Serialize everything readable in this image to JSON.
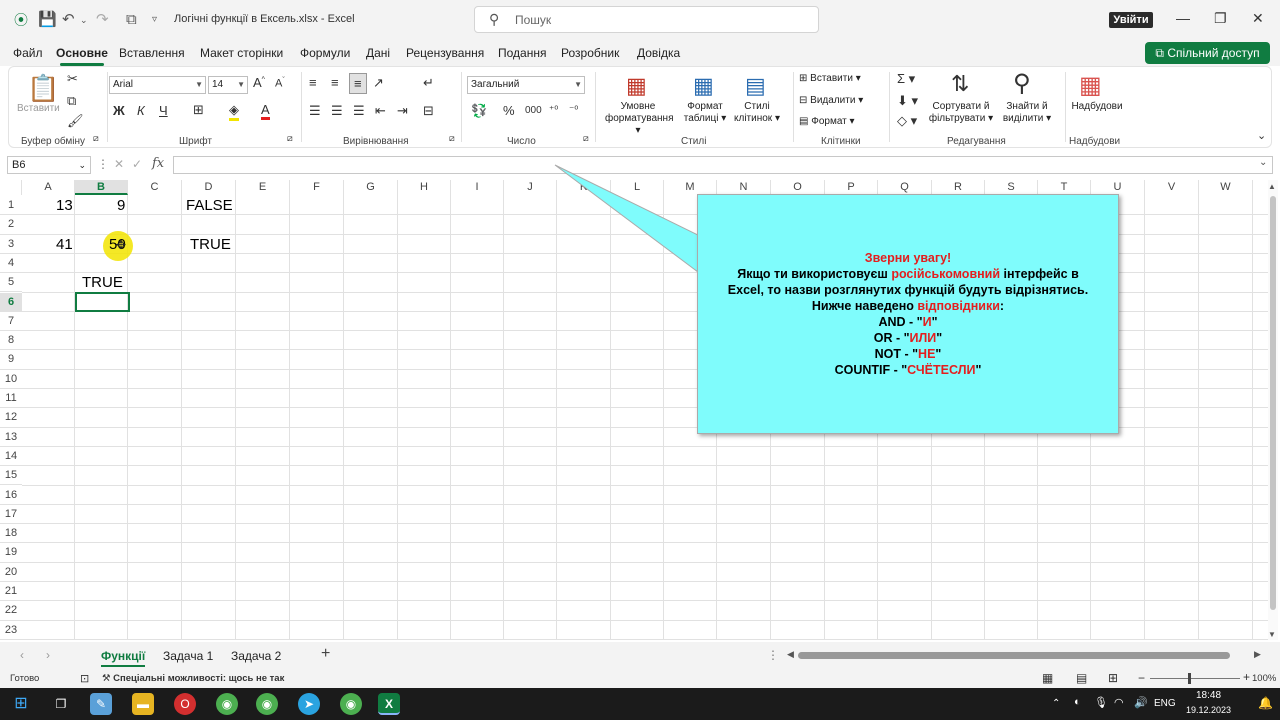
{
  "title_bar": {
    "title": "Логічні функції в Ексель.xlsx  -  Excel",
    "search_placeholder": "Пошук",
    "signin_label": "Увійти"
  },
  "menu": {
    "items": [
      "Файл",
      "Основне",
      "Вставлення",
      "Макет сторінки",
      "Формули",
      "Дані",
      "Рецензування",
      "Подання",
      "Розробник",
      "Довідка"
    ],
    "active": "Основне",
    "share_label": "Спільний доступ"
  },
  "ribbon": {
    "paste_label": "Вставити",
    "font_name": "Arial",
    "font_size": "14",
    "number_format": "Загальний",
    "cond_format": "Умовне",
    "cond_format2": "форматування",
    "format_table": "Формат",
    "format_table2": "таблиці",
    "cell_styles": "Стилі",
    "cell_styles2": "клітинок",
    "insert": "Вставити",
    "delete": "Видалити",
    "format": "Формат",
    "sort": "Сортувати й",
    "sort2": "фільтрувати",
    "find": "Знайти й",
    "find2": "виділити",
    "addins": "Надбудови",
    "groups": [
      "Буфер обміну",
      "Шрифт",
      "Вирівнювання",
      "Число",
      "Стилі",
      "Клітинки",
      "Редагування",
      "Надбудови"
    ]
  },
  "formula_bar": {
    "name_box": "B6",
    "fx_label": "fx",
    "formula": ""
  },
  "grid": {
    "columns": [
      "A",
      "B",
      "C",
      "D",
      "E",
      "F",
      "G",
      "H",
      "I",
      "J",
      "K",
      "L",
      "M",
      "N",
      "O",
      "P",
      "Q",
      "R",
      "S",
      "T",
      "U",
      "V",
      "W"
    ],
    "rows": [
      "1",
      "2",
      "3",
      "4",
      "5",
      "6",
      "7",
      "8",
      "9",
      "10",
      "11",
      "12",
      "13",
      "14",
      "15",
      "16",
      "17",
      "18",
      "19",
      "20",
      "21",
      "22",
      "23"
    ],
    "selected_column": "B",
    "selected_row": "6",
    "cells": {
      "A1": "13",
      "B1": "9",
      "D1": "FALSE",
      "A3": "41",
      "B3": "50",
      "D3": "TRUE",
      "B5": "TRUE"
    }
  },
  "callout": {
    "heading": "Зверни увагу!",
    "line1_a": "Якщо ти використовуєш ",
    "line1_b": "російськомовний",
    "line1_c": " інтерфейс в",
    "line2": "Excel, то назви розглянутих функцій будуть відрізнятись.",
    "line3_a": "Нижче наведено ",
    "line3_b": "відповідники",
    "line3_c": ":",
    "and_a": "AND - \"",
    "and_b": "И",
    "and_c": "\"",
    "or_a": "OR - \"",
    "or_b": "ИЛИ",
    "or_c": "\"",
    "not_a": "NOT - \"",
    "not_b": "НЕ",
    "not_c": "\"",
    "countif_a": "COUNTIF - \"",
    "countif_b": "СЧЁТЕСЛИ",
    "countif_c": "\""
  },
  "sheet_tabs": {
    "tabs": [
      "Функції",
      "Задача 1",
      "Задача 2"
    ],
    "active": "Функції"
  },
  "status_bar": {
    "ready": "Готово",
    "accessibility": "Спеціальні можливості: щось не так",
    "zoom": "100%"
  },
  "taskbar": {
    "lang": "ENG",
    "time": "18:48",
    "date": "19.12.2023"
  },
  "colors": {
    "accent": "#107c41",
    "callout_bg": "#7ffcfc",
    "callout_red": "#e41e1e",
    "highlight": "#f2e400"
  }
}
